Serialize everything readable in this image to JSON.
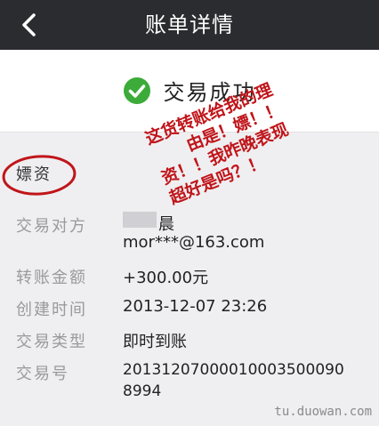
{
  "nav": {
    "title": "账单详情"
  },
  "status": {
    "text": "交易成功"
  },
  "details": {
    "note": "嫖资",
    "counterparty_label": "交易对方",
    "counterparty_name": "晨",
    "counterparty_email": "mor***@163.com",
    "amount_label": "转账金额",
    "amount_value": "+300.00元",
    "created_label": "创建时间",
    "created_value": "2013-12-07 23:26",
    "type_label": "交易类型",
    "type_value": "即时到账",
    "txn_label": "交易号",
    "txn_value_line1": "20131207000010003500090",
    "txn_value_line2": "8994"
  },
  "annotation": {
    "lines": [
      "这货转账给我的理",
      "由是！嫖！！",
      "资！！我昨晚表现",
      "超好是吗？！"
    ],
    "color": "#c0151a"
  },
  "watermark": "tu.duowan.com",
  "icons": {
    "back": "chevron-left-icon",
    "success": "checkmark-circle-icon"
  },
  "colors": {
    "navbar": "#2b2c30",
    "success": "#3cab39",
    "details_bg": "#efeff1"
  }
}
